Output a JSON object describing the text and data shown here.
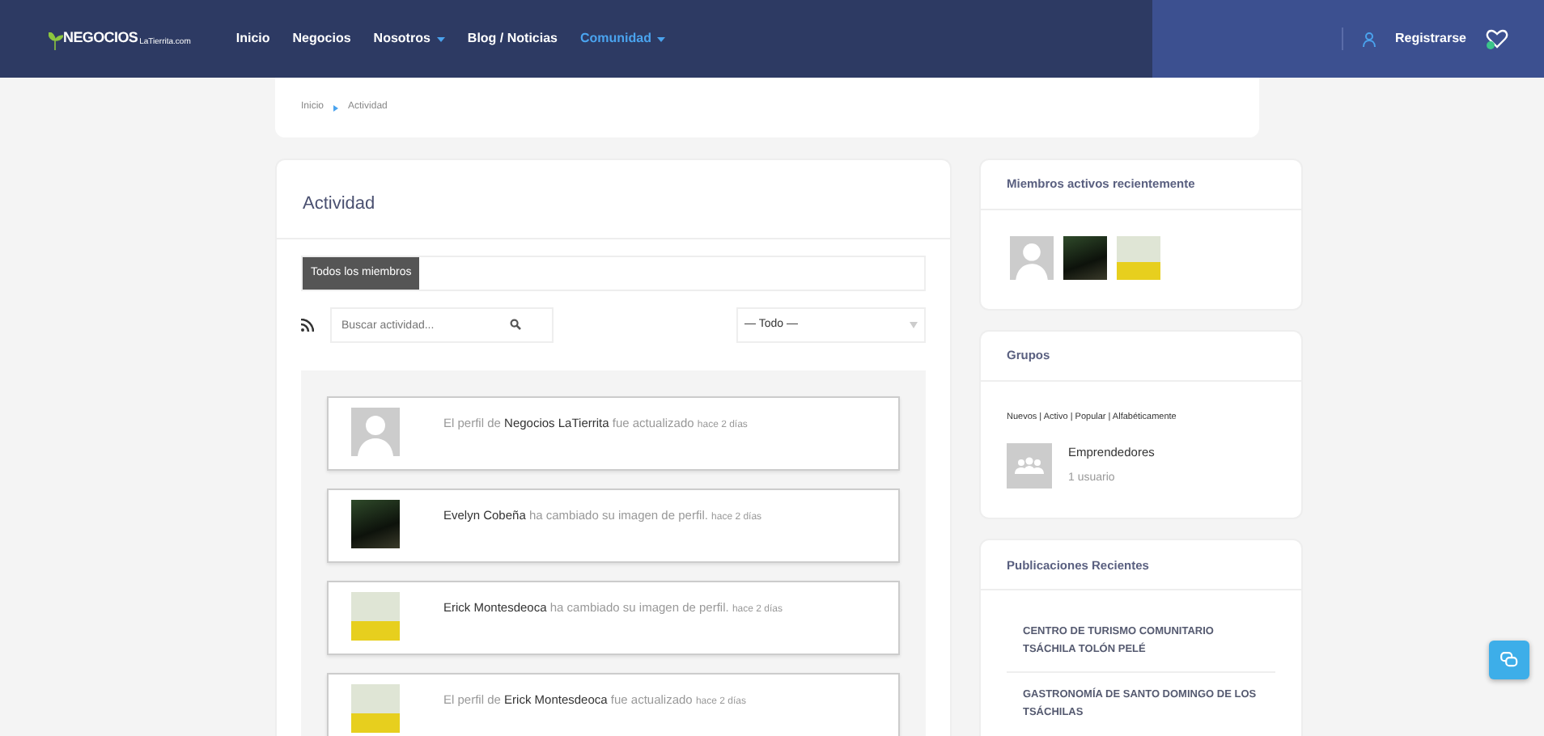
{
  "navbar": {
    "logo": {
      "main": "NEGOCIOS",
      "sub": "LaTierrita.com"
    },
    "items": [
      {
        "label": "Inicio",
        "selected": false,
        "dropdown": false
      },
      {
        "label": "Negocios",
        "selected": false,
        "dropdown": false
      },
      {
        "label": "Nosotros",
        "selected": false,
        "dropdown": true
      },
      {
        "label": "Blog / Noticias",
        "selected": false,
        "dropdown": false
      },
      {
        "label": "Comunidad",
        "selected": true,
        "dropdown": true
      }
    ],
    "register": "Registrarse"
  },
  "breadcrumb": [
    "Inicio",
    "Actividad"
  ],
  "activity": {
    "title": "Actividad",
    "tabs": [
      {
        "label": "Todos los miembros",
        "selected": true
      }
    ],
    "search": {
      "placeholder": "Buscar actividad..."
    },
    "filter": {
      "value": "— Todo —"
    },
    "items": [
      {
        "avatar": {
          "kind": "silhouette"
        },
        "text": "El perfil de **Negocios LaTierrita** fue actualizado",
        "time": "hace 2 días"
      },
      {
        "avatar": {
          "kind": "night"
        },
        "text": "**Evelyn Cobeña** ha cambiado su imagen de perfil.",
        "time": "hace 2 días"
      },
      {
        "avatar": {
          "kind": "yellow"
        },
        "text": "**Erick Montesdeoca** ha cambiado su imagen de perfil.",
        "time": "hace 2 días"
      },
      {
        "avatar": {
          "kind": "yellow"
        },
        "text": "El perfil de **Erick Montesdeoca** fue actualizado",
        "time": "hace 2 días"
      }
    ]
  },
  "sidebar": {
    "members": {
      "title": "Miembros activos recientemente",
      "avatars": [
        {
          "kind": "silhouette"
        },
        {
          "kind": "night"
        },
        {
          "kind": "yellow"
        }
      ]
    },
    "groups": {
      "title": "Grupos",
      "filters": "Nuevos | Activo | Popular | Alfabéticamente",
      "items": [
        {
          "name": "Emprendedores",
          "count": "1 usuario"
        }
      ]
    },
    "posts": {
      "title": "Publicaciones Recientes",
      "items": [
        "CENTRO DE TURISMO COMUNITARIO TSÁCHILA TOLÓN PELÉ",
        "GASTRONOMÍA DE SANTO DOMINGO DE LOS TSÁCHILAS"
      ]
    }
  }
}
